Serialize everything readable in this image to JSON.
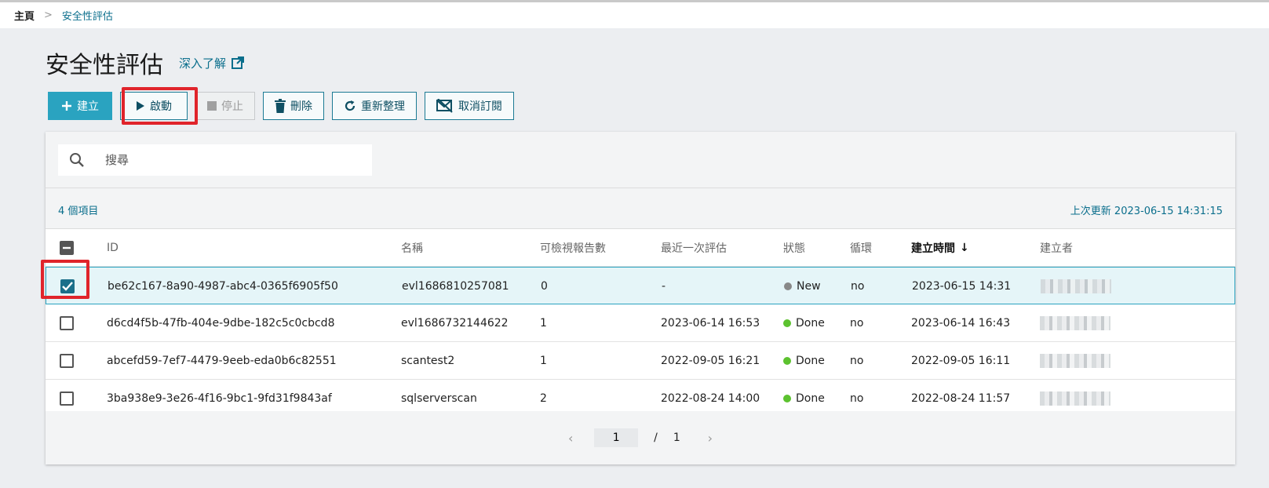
{
  "breadcrumb": {
    "home": "主頁",
    "separator": ">",
    "current": "安全性評估"
  },
  "page": {
    "title": "安全性評估",
    "learn_more": "深入了解"
  },
  "toolbar": {
    "create": "建立",
    "start": "啟動",
    "stop": "停止",
    "delete": "刪除",
    "refresh": "重新整理",
    "unsubscribe": "取消訂閱"
  },
  "search": {
    "placeholder": "搜尋"
  },
  "info": {
    "item_count": "4 個項目",
    "last_update": "上次更新 2023-06-15 14:31:15"
  },
  "table": {
    "columns": {
      "id": "ID",
      "name": "名稱",
      "reports": "可檢視報告數",
      "last_eval": "最近一次評估",
      "status": "狀態",
      "loop": "循環",
      "created": "建立時間",
      "creator": "建立者"
    },
    "sort_indicator": "↓",
    "rows": [
      {
        "id": "be62c167-8a90-4987-abc4-0365f6905f50",
        "name": "evl1686810257081",
        "reports": "0",
        "last_eval": "-",
        "status": "New",
        "status_color": "#888888",
        "loop": "no",
        "created": "2023-06-15 14:31",
        "selected": true
      },
      {
        "id": "d6cd4f5b-47fb-404e-9dbe-182c5c0cbcd8",
        "name": "evl1686732144622",
        "reports": "1",
        "last_eval": "2023-06-14 16:53",
        "status": "Done",
        "status_color": "#5cc22f",
        "loop": "no",
        "created": "2023-06-14 16:43",
        "selected": false
      },
      {
        "id": "abcefd59-7ef7-4479-9eeb-eda0b6c82551",
        "name": "scantest2",
        "reports": "1",
        "last_eval": "2022-09-05 16:21",
        "status": "Done",
        "status_color": "#5cc22f",
        "loop": "no",
        "created": "2022-09-05 16:11",
        "selected": false
      },
      {
        "id": "3ba938e9-3e26-4f16-9bc1-9fd31f9843af",
        "name": "sqlserverscan",
        "reports": "2",
        "last_eval": "2022-08-24 14:00",
        "status": "Done",
        "status_color": "#5cc22f",
        "loop": "no",
        "created": "2022-08-24 11:57",
        "selected": false
      }
    ]
  },
  "pagination": {
    "current": "1",
    "separator": "/",
    "total": "1",
    "prev": "‹",
    "next": "›"
  },
  "colors": {
    "accent": "#2aa3c0",
    "link": "#0a6e8c",
    "highlight": "#e0242b"
  }
}
